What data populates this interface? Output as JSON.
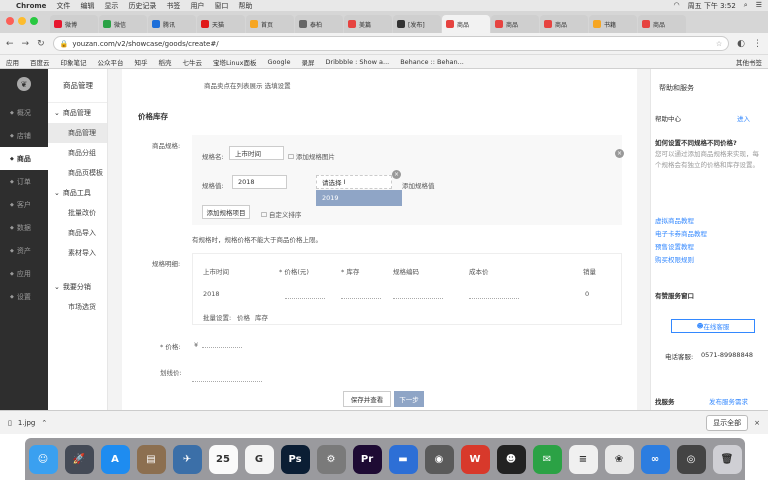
{
  "menubar": {
    "app": "Chrome",
    "items": [
      "文件",
      "编辑",
      "显示",
      "历史记录",
      "书签",
      "用户",
      "窗口",
      "帮助"
    ],
    "clock": "周五 下午 3:52"
  },
  "tabs": [
    {
      "label": "微博",
      "color": "#e6162d"
    },
    {
      "label": "微信",
      "color": "#2ba245"
    },
    {
      "label": "腾讯",
      "color": "#1e6fd9"
    },
    {
      "label": "天猫",
      "color": "#e01a1a"
    },
    {
      "label": "首页",
      "color": "#f6a623"
    },
    {
      "label": "泰柏",
      "color": "#666666"
    },
    {
      "label": "美篇",
      "color": "#e64340"
    },
    {
      "label": "[发布]",
      "color": "#333333"
    },
    {
      "label": "商品",
      "color": "#e64340",
      "active": true
    },
    {
      "label": "商品",
      "color": "#e64340"
    },
    {
      "label": "商品",
      "color": "#e64340"
    },
    {
      "label": "书籍",
      "color": "#f6a623"
    },
    {
      "label": "商品",
      "color": "#e64340"
    }
  ],
  "urlbar": {
    "url": "youzan.com/v2/showcase/goods/create#/"
  },
  "bookmarks": [
    "应用",
    "百度云",
    "印象笔记",
    "公众平台",
    "知乎",
    "稻壳",
    "七牛云",
    "宝塔Linux面板",
    "Google",
    "录屏",
    "Dribbble : Show a...",
    "Behance :: Behan..."
  ],
  "bookmarks_end": "其他书签",
  "leftnav": {
    "items": [
      {
        "label": "概况",
        "active": false
      },
      {
        "label": "店铺",
        "active": false
      },
      {
        "label": "商品",
        "active": true
      },
      {
        "label": "订单",
        "active": false
      },
      {
        "label": "客户",
        "active": false
      },
      {
        "label": "数据",
        "active": false
      },
      {
        "label": "资产",
        "active": false
      },
      {
        "label": "应用",
        "active": false
      },
      {
        "label": "设置",
        "active": false
      }
    ]
  },
  "subnav": {
    "title": "商品管理",
    "group1": "商品管理",
    "group1_items": [
      "商品管理",
      "商品分组",
      "商品页模板"
    ],
    "group2": "商品工具",
    "group2_items": [
      "批量改价",
      "商品导入",
      "素材导入"
    ],
    "group3": "我要分销",
    "group3_items": [
      "市场选货"
    ]
  },
  "form": {
    "top_hint": "商品卖点在列表展示  选填设置",
    "section_title": "价格库存",
    "spec_label": "商品规格:",
    "spec_name_label": "规格名:",
    "spec_name_value": "上市时间",
    "add_spec_image": "添加规格图片",
    "spec_value_label": "规格值:",
    "spec_value_value": "2018",
    "dropdown_placeholder": "请选择",
    "dropdown_option": "2019",
    "add_spec_value": "添加规格值",
    "add_spec_item_button": "添加规格项目",
    "custom_sort": "自定义排序",
    "spec_hint": "有规格时，规格价格不能大于商品价格上限。",
    "detail_label": "规格明细:",
    "table_headers": [
      "上市时间",
      "* 价格(元)",
      "* 库存",
      "规格编码",
      "成本价",
      "销量"
    ],
    "table_row": {
      "time": "2018",
      "sales": "0"
    },
    "batch_label": "批量设置:",
    "batch_options": [
      "价格",
      "库存"
    ],
    "price_label": "* 价格:",
    "price_symbol": "¥",
    "original_price_label": "划线价:",
    "save_button": "保存并查看",
    "next_button": "下一步"
  },
  "rightpanel": {
    "title": "帮助和服务",
    "help_center": "帮助中心",
    "enter": "进入",
    "question": "如何设置不同规格不同价格?",
    "answer": "您可以通过添加商品规格来实现，每个规格会有独立的价格和库存设置。",
    "links": [
      "虚拟商品教程",
      "电子卡券商品教程",
      "预售设置教程",
      "购买权限规则"
    ],
    "service_window": "有赞服务窗口",
    "online_service": "在线客服",
    "phone_label": "电话客服:",
    "phone": "0571-89988848",
    "find_service": "找服务",
    "publish_request": "发布服务需求"
  },
  "download": {
    "file": "1.jpg",
    "show_all": "显示全部"
  },
  "dock": [
    {
      "name": "finder-icon",
      "color": "#3aa0f0",
      "glyph": "☺"
    },
    {
      "name": "launchpad-icon",
      "color": "#444a56",
      "glyph": "🚀"
    },
    {
      "name": "appstore-icon",
      "color": "#1e8cf0",
      "glyph": "A"
    },
    {
      "name": "preview-icon",
      "color": "#8c6f50",
      "glyph": "▤"
    },
    {
      "name": "rocket-typist-icon",
      "color": "#3b6fa8",
      "glyph": "✈"
    },
    {
      "name": "calendar-icon",
      "color": "#fafafa",
      "glyph": "25"
    },
    {
      "name": "gitkraken-icon",
      "color": "#f4f4f4",
      "glyph": "G"
    },
    {
      "name": "photoshop-icon",
      "color": "#0b1e34",
      "glyph": "Ps"
    },
    {
      "name": "system-prefs-icon",
      "color": "#7a7a7a",
      "glyph": "⚙"
    },
    {
      "name": "premiere-icon",
      "color": "#1e0b34",
      "glyph": "Pr"
    },
    {
      "name": "keynote-icon",
      "color": "#2d6fd6",
      "glyph": "▬"
    },
    {
      "name": "quicktime-icon",
      "color": "#5a5a5a",
      "glyph": "◉"
    },
    {
      "name": "wps-icon",
      "color": "#d8392b",
      "glyph": "W"
    },
    {
      "name": "qq-icon",
      "color": "#222222",
      "glyph": "☻"
    },
    {
      "name": "wechat-icon",
      "color": "#2ba245",
      "glyph": "✉"
    },
    {
      "name": "notes-icon",
      "color": "#f0f0f0",
      "glyph": "≡"
    },
    {
      "name": "photos-icon",
      "color": "#e8e8e8",
      "glyph": "❀"
    },
    {
      "name": "baidu-netdisk-icon",
      "color": "#2c7de0",
      "glyph": "∞"
    },
    {
      "name": "camera-icon",
      "color": "#444444",
      "glyph": "◎"
    },
    {
      "name": "trash-icon",
      "color": "#cfcfd4",
      "glyph": "🗑"
    }
  ]
}
